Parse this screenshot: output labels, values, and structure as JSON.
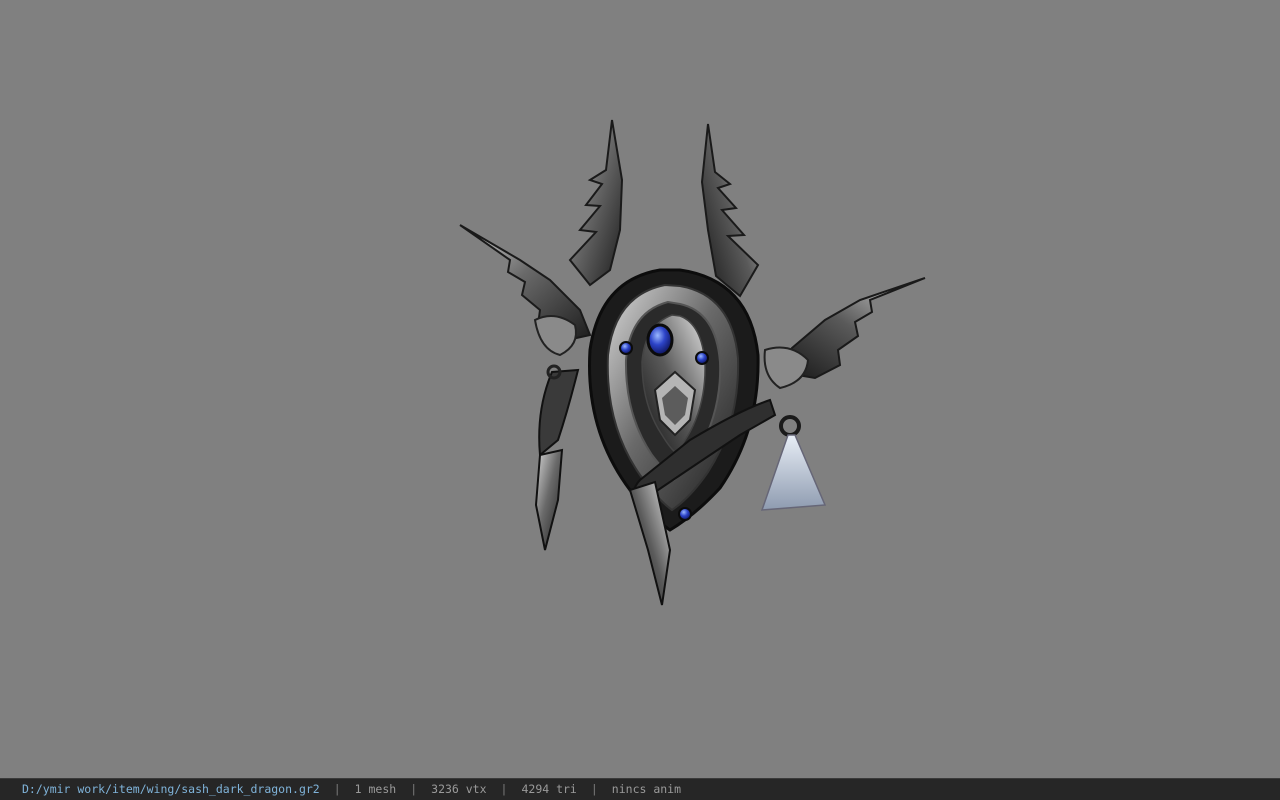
{
  "viewer": {
    "background_color": "#808080",
    "model_name": "sash_dark_dragon",
    "model_icon": "dark-dragon-sash-model"
  },
  "statusbar": {
    "file_path": "D:/ymir work/item/wing/sash_dark_dragon.gr2",
    "separator": "|",
    "mesh_count": "1 mesh",
    "vertex_count": "3236 vtx",
    "triangle_count": "4294 tri",
    "anim_info": "nincs anim",
    "path_color": "#7fb3d9",
    "background_color": "#262626"
  }
}
